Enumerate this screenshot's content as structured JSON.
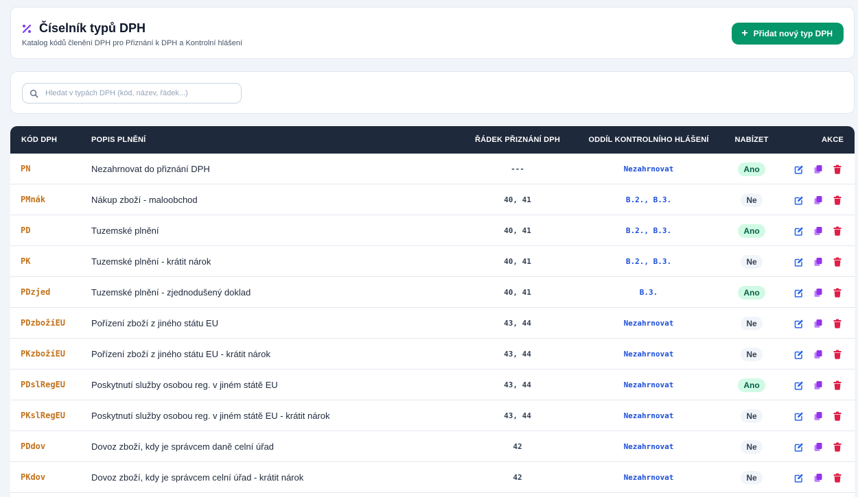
{
  "header": {
    "title": "Číselník typů DPH",
    "subtitle": "Katalog kódů členění DPH pro Přiznání k DPH a Kontrolní hlášení",
    "title_icon": "percent-icon",
    "add_button_label": "Přidat nový typ DPH",
    "add_button_color": "#059669"
  },
  "search": {
    "placeholder": "Hledat v typách DPH (kód, název, řádek...)",
    "value": ""
  },
  "table": {
    "columns": {
      "code": "Kód DPH",
      "description": "Popis plnění",
      "line": "Řádek přiznání DPH",
      "kh": "Oddíl kontrolního hlášení",
      "offer": "Nabízet",
      "actions": "Akce"
    },
    "rows": [
      {
        "code": "PN",
        "description": "Nezahrnovat do přiznání DPH",
        "line": "---",
        "kh": "Nezahrnovat",
        "offer": "Ano",
        "offer_yes": true
      },
      {
        "code": "PMnák",
        "description": "Nákup zboží - maloobchod",
        "line": "40, 41",
        "kh": "B.2., B.3.",
        "offer": "Ne",
        "offer_yes": false
      },
      {
        "code": "PD",
        "description": "Tuzemské plnění",
        "line": "40, 41",
        "kh": "B.2., B.3.",
        "offer": "Ano",
        "offer_yes": true
      },
      {
        "code": "PK",
        "description": "Tuzemské plnění - krátit nárok",
        "line": "40, 41",
        "kh": "B.2., B.3.",
        "offer": "Ne",
        "offer_yes": false
      },
      {
        "code": "PDzjed",
        "description": "Tuzemské plnění - zjednodušený doklad",
        "line": "40, 41",
        "kh": "B.3.",
        "offer": "Ano",
        "offer_yes": true
      },
      {
        "code": "PDzbožíEU",
        "description": "Pořízení zboží z jiného státu EU",
        "line": "43, 44",
        "kh": "Nezahrnovat",
        "offer": "Ne",
        "offer_yes": false
      },
      {
        "code": "PKzbožíEU",
        "description": "Pořízení zboží z jiného státu EU - krátit nárok",
        "line": "43, 44",
        "kh": "Nezahrnovat",
        "offer": "Ne",
        "offer_yes": false
      },
      {
        "code": "PDslRegEU",
        "description": "Poskytnutí služby osobou reg. v jiném státě EU",
        "line": "43, 44",
        "kh": "Nezahrnovat",
        "offer": "Ano",
        "offer_yes": true
      },
      {
        "code": "PKslRegEU",
        "description": "Poskytnutí služby osobou reg. v jiném státě EU - krátit nárok",
        "line": "43, 44",
        "kh": "Nezahrnovat",
        "offer": "Ne",
        "offer_yes": false
      },
      {
        "code": "PDdov",
        "description": "Dovoz zboží, kdy je správcem daně celní úřad",
        "line": "42",
        "kh": "Nezahrnovat",
        "offer": "Ne",
        "offer_yes": false
      },
      {
        "code": "PKdov",
        "description": "Dovoz zboží, kdy je správcem celní úřad - krátit nárok",
        "line": "42",
        "kh": "Nezahrnovat",
        "offer": "Ne",
        "offer_yes": false
      }
    ],
    "action_icons": [
      "edit-icon",
      "duplicate-icon",
      "delete-icon"
    ]
  },
  "colors": {
    "header_bg": "#1e293b",
    "code_color": "#c2721b",
    "kh_color": "#1d4ed8",
    "yes_badge_bg": "#d1fae5",
    "no_badge_bg": "#f1f5f9",
    "edit_color": "#2563eb",
    "duplicate_color": "#9333ea",
    "delete_color": "#e11d48"
  }
}
